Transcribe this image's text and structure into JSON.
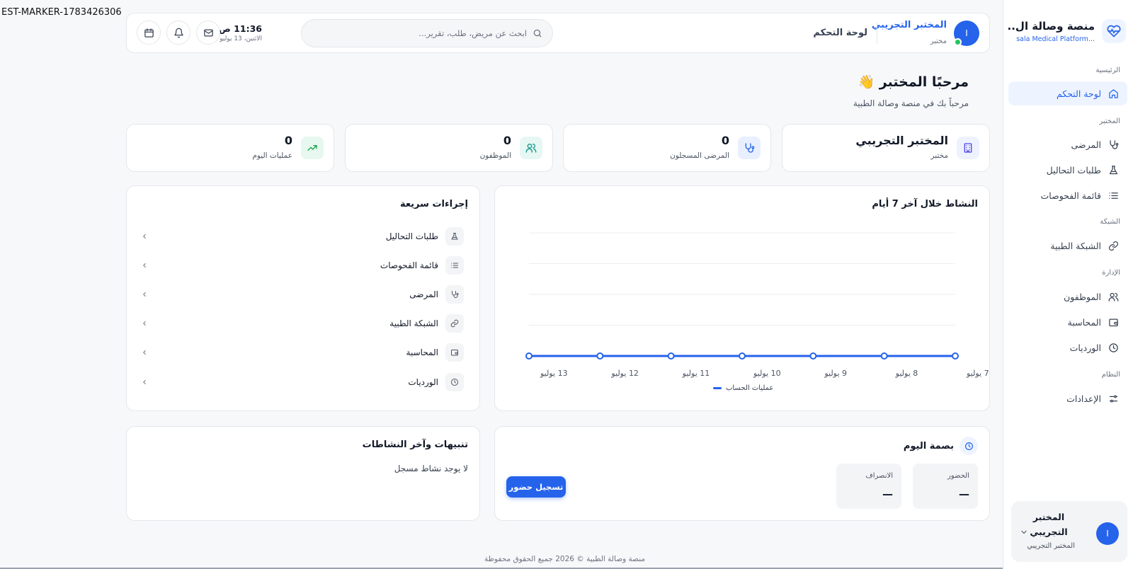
{
  "marker": "EST-MARKER-1783426306",
  "brand": {
    "title": "منصة وصالة ال...",
    "subtitle": "...sala Medical Platform"
  },
  "sidebar": {
    "sections": [
      "الرئيسية",
      "المختبر",
      "الشبكة",
      "الإدارة",
      "النظام"
    ],
    "items": [
      {
        "label": "لوحة التحكم",
        "icon": "home-icon",
        "active": true
      },
      {
        "label": "المرضى",
        "icon": "stethoscope-icon"
      },
      {
        "label": "طلبات التحاليل",
        "icon": "flask-icon"
      },
      {
        "label": "قائمة الفحوصات",
        "icon": "list-icon"
      },
      {
        "label": "الشبكة الطبية",
        "icon": "link-icon"
      },
      {
        "label": "الموظفون",
        "icon": "users-icon"
      },
      {
        "label": "المحاسبة",
        "icon": "wallet-icon"
      },
      {
        "label": "الورديات",
        "icon": "clock-icon"
      },
      {
        "label": "الإعدادات",
        "icon": "sliders-icon"
      }
    ],
    "user": {
      "initial": "I",
      "name": "المختبر التجريبي",
      "role": "المختبر التجريبي"
    }
  },
  "header": {
    "initial": "I",
    "user_name": "المختبر التجريبي",
    "user_role": "مختبر",
    "page_title": "لوحة التحكم",
    "search_placeholder": "ابحث عن مريض، طلب، تقرير...",
    "time": "11:36 ص",
    "date": "الاثنين، 13 يوليو"
  },
  "welcome": {
    "title": "مرحبًا المختبر 👋",
    "subtitle": "مرحباً بك في منصة وصالة الطبية"
  },
  "stats": [
    {
      "value": "المختبر التجريبي",
      "label": "مختبر",
      "icon": "building-icon"
    },
    {
      "value": "0",
      "label": "المرضى المسجلون",
      "icon": "stethoscope-icon"
    },
    {
      "value": "0",
      "label": "الموظفون",
      "icon": "users-icon"
    },
    {
      "value": "0",
      "label": "عمليات اليوم",
      "icon": "trending-up-icon"
    }
  ],
  "activity": {
    "title": "النشاط خلال آخر 7 أيام",
    "legend": "عمليات الحساب"
  },
  "chart_data": {
    "type": "line",
    "title": "النشاط خلال آخر 7 أيام",
    "categories": [
      "7 يوليو",
      "8 يوليو",
      "9 يوليو",
      "10 يوليو",
      "11 يوليو",
      "12 يوليو",
      "13 يوليو"
    ],
    "series": [
      {
        "name": "عمليات الحساب",
        "values": [
          0,
          0,
          0,
          0,
          0,
          0,
          0
        ],
        "color": "#2563eb"
      }
    ],
    "ylim": [
      0,
      4
    ],
    "grid": true,
    "legend": "bottom-center"
  },
  "quick_actions": {
    "title": "إجراءات سريعة",
    "items": [
      {
        "label": "طلبات التحاليل",
        "icon": "flask-icon"
      },
      {
        "label": "قائمة الفحوصات",
        "icon": "list-icon"
      },
      {
        "label": "المرضى",
        "icon": "stethoscope-icon"
      },
      {
        "label": "الشبكة الطبية",
        "icon": "link-icon"
      },
      {
        "label": "المحاسبة",
        "icon": "wallet-icon"
      },
      {
        "label": "الورديات",
        "icon": "clock-icon"
      }
    ]
  },
  "fingerprint": {
    "title": "بصمة اليوم",
    "attendance_label": "الحضور",
    "attendance_value": "—",
    "departure_label": "الانصراف",
    "departure_value": "—",
    "button": "تسجيل حضور"
  },
  "alerts": {
    "title": "تنبيهات وآخر النشاطات",
    "empty": "لا يوجد نشاط مسجل"
  },
  "footer": "منصة وصالة الطبية © 2026 جميع الحقوق محفوظة",
  "colors": {
    "accent": "#2563eb",
    "success": "#22c55e",
    "background": "#f7f8fa"
  }
}
